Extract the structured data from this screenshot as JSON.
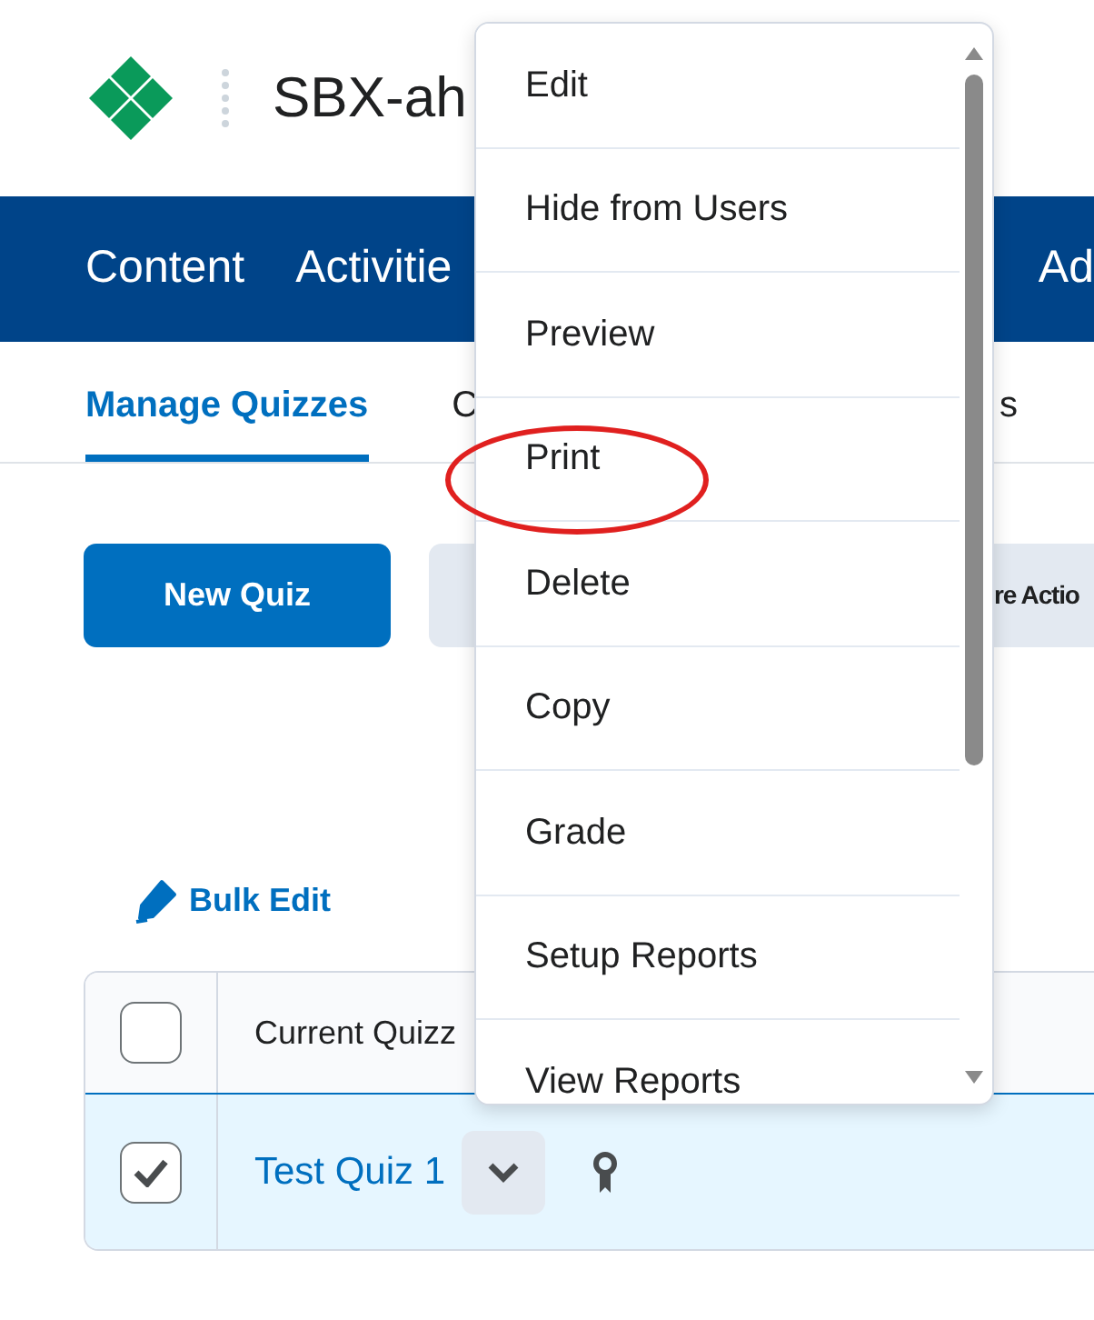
{
  "header": {
    "course_title": "SBX-ah"
  },
  "navbar": {
    "items": [
      {
        "label": "Content"
      },
      {
        "label": "Activitie"
      },
      {
        "label": "Ad"
      }
    ]
  },
  "tabs": [
    {
      "label": "Manage Quizzes",
      "selected": true
    },
    {
      "label": "C",
      "selected": false
    },
    {
      "label": "s",
      "selected": false
    }
  ],
  "toolbar": {
    "buttons": [
      {
        "label": "New Quiz",
        "kind": "primary"
      },
      {
        "label": "re Actio",
        "kind": "secondary"
      }
    ]
  },
  "bulk_edit": {
    "label": "Bulk Edit"
  },
  "table": {
    "header": {
      "checked": false,
      "label": "Current Quizz"
    },
    "rows": [
      {
        "checked": true,
        "selected": true,
        "title": "Test Quiz 1"
      }
    ]
  },
  "context_menu": {
    "items": [
      {
        "label": "Edit",
        "highlighted": false
      },
      {
        "label": "Hide from Users",
        "highlighted": false
      },
      {
        "label": "Preview",
        "highlighted": false
      },
      {
        "label": "Print",
        "highlighted": true
      },
      {
        "label": "Delete",
        "highlighted": false
      },
      {
        "label": "Copy",
        "highlighted": false
      },
      {
        "label": "Grade",
        "highlighted": false
      },
      {
        "label": "Setup Reports",
        "highlighted": false
      },
      {
        "label": "View Reports",
        "highlighted": false
      }
    ]
  }
}
